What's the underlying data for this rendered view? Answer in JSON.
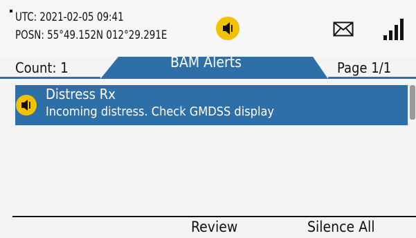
{
  "status": {
    "utc": "UTC:  2021-02-05  09:41",
    "posn": "POSN: 55°49.152N  012°29.291E",
    "icons": [
      "speaker-icon",
      "mail-icon",
      "signal-strength-icon"
    ],
    "alert_color": "#f2c200"
  },
  "tabs": {
    "count_label": "Count: 1",
    "title": "BAM Alerts",
    "page_label": "Page 1/1",
    "active_color": "#2f6fa8"
  },
  "alerts": [
    {
      "title": "Distress Rx",
      "description": "Incoming distress. Check GMDSS display",
      "icon": "speaker-icon"
    }
  ],
  "softkeys": {
    "review": "Review",
    "silence_all": "Silence All"
  }
}
